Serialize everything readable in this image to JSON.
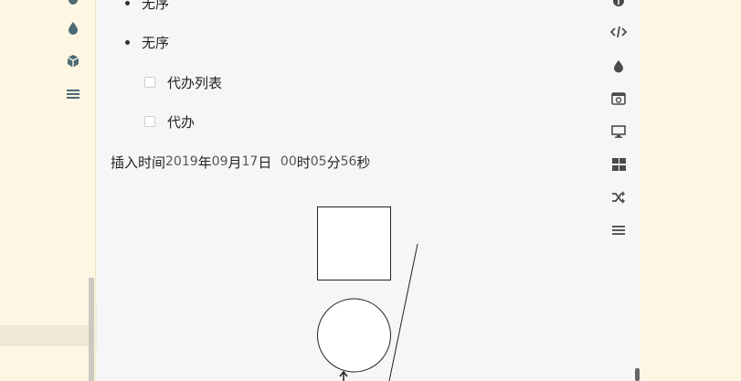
{
  "sidebar": {
    "icons": [
      "circle-icon",
      "drop-icon",
      "cube-icon",
      "menu-icon"
    ]
  },
  "editor": {
    "list": [
      {
        "type": "bullet",
        "text": "无序"
      },
      {
        "type": "bullet",
        "text": "无序"
      },
      {
        "type": "todo",
        "text": "代办列表",
        "checked": false
      },
      {
        "type": "todo",
        "text": "代办",
        "checked": false
      }
    ],
    "timestamp": {
      "prefix": "插入时间",
      "year": "2019",
      "year_unit": "年",
      "month": "09",
      "month_unit": "月",
      "day": "17",
      "day_unit": "日",
      "hour": "00",
      "hour_unit": "时",
      "minute": "05",
      "minute_unit": "分",
      "second": "56",
      "second_unit": "秒"
    }
  },
  "toolbar": {
    "icons": [
      "info-icon",
      "code-icon",
      "drop-icon",
      "image-icon",
      "monitor-icon",
      "grid-icon",
      "shuffle-icon",
      "menu-icon"
    ]
  }
}
